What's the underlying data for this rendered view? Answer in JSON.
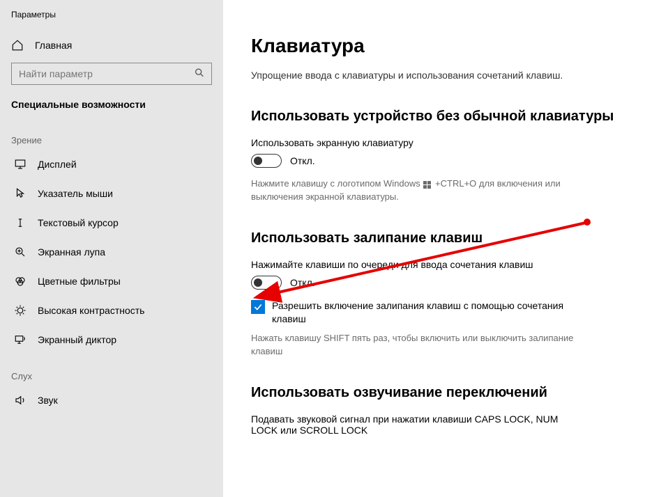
{
  "app_title": "Параметры",
  "home_label": "Главная",
  "search_placeholder": "Найти параметр",
  "section_title": "Специальные возможности",
  "categories": {
    "vision": "Зрение",
    "hearing": "Слух"
  },
  "nav": {
    "display": "Дисплей",
    "mouse_pointer": "Указатель мыши",
    "text_cursor": "Текстовый курсор",
    "magnifier": "Экранная лупа",
    "color_filters": "Цветные фильтры",
    "high_contrast": "Высокая контрастность",
    "narrator": "Экранный диктор",
    "audio": "Звук"
  },
  "page": {
    "title": "Клавиатура",
    "subtitle": "Упрощение ввода с клавиатуры и использования сочетаний клавиш."
  },
  "section1": {
    "heading": "Использовать устройство без обычной клавиатуры",
    "label": "Использовать экранную клавиатуру",
    "toggle_state": "Откл.",
    "hint_prefix": "Нажмите клавишу с логотипом Windows",
    "hint_suffix": "+CTRL+O для включения или выключения экранной клавиатуры."
  },
  "section2": {
    "heading": "Использовать залипание клавиш",
    "label": "Нажимайте клавиши по очереди для ввода сочетания клавиш",
    "toggle_state": "Откл.",
    "checkbox_label": "Разрешить включение залипания клавиш с помощью сочетания клавиш",
    "hint": "Нажать клавишу SHIFT пять раз, чтобы включить или выключить залипание клавиш"
  },
  "section3": {
    "heading": "Использовать озвучивание переключений",
    "label": "Подавать звуковой сигнал при нажатии клавиши CAPS LOCK, NUM LOCK или SCROLL LOCK"
  }
}
